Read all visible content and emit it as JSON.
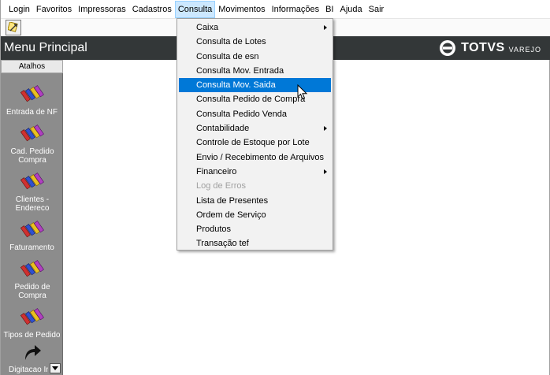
{
  "menubar": {
    "items": [
      "Login",
      "Favoritos",
      "Impressoras",
      "Cadastros",
      "Consulta",
      "Movimentos",
      "Informações",
      "BI",
      "Ajuda",
      "Sair"
    ],
    "active_index": 4
  },
  "toolbar": {
    "button_icon": "wrench-icon"
  },
  "header": {
    "title": "Menu Principal",
    "brand": "TOTVS",
    "brand_sub": "VAREJO"
  },
  "sidebar": {
    "header": "Atalhos",
    "items": [
      {
        "label": "Entrada de NF",
        "icon": "crayons-icon"
      },
      {
        "label": "Cad. Pedido Compra",
        "icon": "crayons-icon"
      },
      {
        "label": "Clientes - Endereco",
        "icon": "crayons-icon"
      },
      {
        "label": "Faturamento",
        "icon": "crayons-icon"
      },
      {
        "label": "Pedido de Compra",
        "icon": "crayons-icon"
      },
      {
        "label": "Tipos de Pedido",
        "icon": "crayons-icon"
      },
      {
        "label": "Digitacao In",
        "icon": "arrow-icon"
      }
    ]
  },
  "consulta_menu": {
    "items": [
      {
        "label": "Caixa",
        "submenu": true,
        "disabled": false
      },
      {
        "label": "Consulta de Lotes",
        "submenu": false,
        "disabled": false
      },
      {
        "label": "Consulta de esn",
        "submenu": false,
        "disabled": false
      },
      {
        "label": "Consulta Mov. Entrada",
        "submenu": false,
        "disabled": false
      },
      {
        "label": "Consulta Mov. Saida",
        "submenu": false,
        "disabled": false,
        "highlighted": true
      },
      {
        "label": "Consulta Pedido de Compra",
        "submenu": false,
        "disabled": false
      },
      {
        "label": "Consulta Pedido Venda",
        "submenu": false,
        "disabled": false
      },
      {
        "label": "Contabilidade",
        "submenu": true,
        "disabled": false
      },
      {
        "label": "Controle de Estoque por Lote",
        "submenu": false,
        "disabled": false
      },
      {
        "label": "Envio / Recebimento de Arquivos",
        "submenu": false,
        "disabled": false
      },
      {
        "label": "Financeiro",
        "submenu": true,
        "disabled": false
      },
      {
        "label": "Log de Erros",
        "submenu": false,
        "disabled": true
      },
      {
        "label": "Lista de Presentes",
        "submenu": false,
        "disabled": false
      },
      {
        "label": "Ordem de Serviço",
        "submenu": false,
        "disabled": false
      },
      {
        "label": "Produtos",
        "submenu": false,
        "disabled": false
      },
      {
        "label": "Transação tef",
        "submenu": false,
        "disabled": false
      }
    ]
  },
  "colors": {
    "header_bg": "#333738",
    "sidebar_bg": "#8c8c8c",
    "highlight": "#0078d7",
    "active_menu": "#cce8ff"
  }
}
